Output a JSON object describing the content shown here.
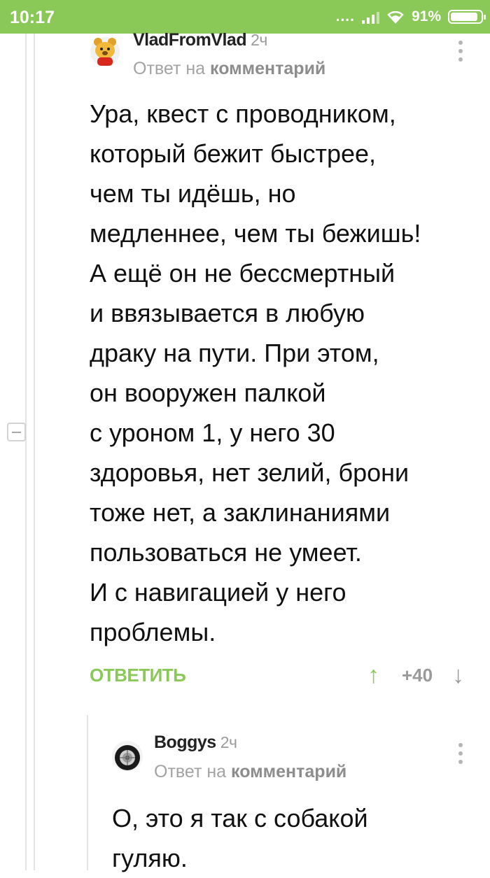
{
  "status_bar": {
    "time": "10:17",
    "network_dots": "....",
    "battery": "91%",
    "battery_level": 0.91,
    "accent": "#8ac858"
  },
  "comments": [
    {
      "author": "VladFromVlad",
      "time_ago": "2ч",
      "reply_prefix": "Ответ на",
      "reply_link": "комментарий",
      "text": "Ура, квест с проводником,\nкоторый бежит быстрее,\nчем ты идёшь, но\nмедленнее, чем ты бежишь!\nА ещё он не бессмертный\nи ввязывается в любую\nдраку на пути. При этом,\nон вооружен палкой\nс уроном 1, у него 30\nздоровья, нет зелий, брони\nтоже нет, а заклинаниями\nпользоваться не умеет.\nИ с навигацией у него\nпроблемы.",
      "reply_button": "ОТВЕТИТЬ",
      "rating": "+40",
      "avatar_icon": "bear-avatar-icon"
    },
    {
      "author": "Boggys",
      "time_ago": "2ч",
      "reply_prefix": "Ответ на",
      "reply_link": "комментарий",
      "text": "О, это я так с собакой\nгуляю.",
      "avatar_icon": "wheel-avatar-icon"
    }
  ]
}
